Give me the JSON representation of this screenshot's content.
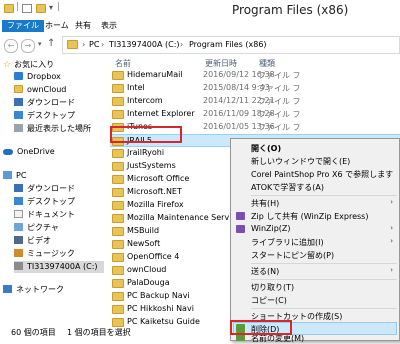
{
  "window": {
    "title": "Program Files (x86)"
  },
  "ribbon": {
    "tabs": [
      "ファイル",
      "ホーム",
      "共有",
      "表示"
    ]
  },
  "address": {
    "crumbs": [
      "PC",
      "TI31397400A (C:)",
      "Program Files (x86)"
    ]
  },
  "navpane": {
    "favorites_label": "お気に入り",
    "favorites": [
      "Dropbox",
      "ownCloud",
      "ダウンロード",
      "デスクトップ",
      "最近表示した場所"
    ],
    "onedrive": "OneDrive",
    "pc": "PC",
    "pc_items": [
      "ダウンロード",
      "デスクトップ",
      "ドキュメント",
      "ピクチャ",
      "ビデオ",
      "ミュージック",
      "TI31397400A (C:)"
    ],
    "network": "ネットワーク"
  },
  "columns": {
    "name": "名前",
    "date": "更新日時",
    "type": "種類"
  },
  "files": [
    {
      "name": "HidemaruMail",
      "date": "2016/09/12 16:38",
      "type": "ファイル フ"
    },
    {
      "name": "Intel",
      "date": "2015/08/14 9:43",
      "type": "ファイル フ"
    },
    {
      "name": "Intercom",
      "date": "2014/12/11 22:21",
      "type": "ファイル フ"
    },
    {
      "name": "Internet Explorer",
      "date": "2016/11/09 18:28",
      "type": "ファイル フ"
    },
    {
      "name": "iTunes",
      "date": "2016/01/05 13:36",
      "type": "ファイル フ"
    },
    {
      "name": "JRAIL5",
      "date": "",
      "type": ""
    },
    {
      "name": "JrailRyohi",
      "date": "",
      "type": ""
    },
    {
      "name": "JustSystems",
      "date": "",
      "type": ""
    },
    {
      "name": "Microsoft Office",
      "date": "",
      "type": ""
    },
    {
      "name": "Microsoft.NET",
      "date": "",
      "type": ""
    },
    {
      "name": "Mozilla Firefox",
      "date": "",
      "type": ""
    },
    {
      "name": "Mozilla Maintenance Service",
      "date": "",
      "type": ""
    },
    {
      "name": "MSBuild",
      "date": "",
      "type": ""
    },
    {
      "name": "NewSoft",
      "date": "",
      "type": ""
    },
    {
      "name": "OpenOffice 4",
      "date": "",
      "type": ""
    },
    {
      "name": "ownCloud",
      "date": "",
      "type": ""
    },
    {
      "name": "PalaDouga",
      "date": "",
      "type": ""
    },
    {
      "name": "PC Backup Navi",
      "date": "",
      "type": ""
    },
    {
      "name": "PC Hikkoshi Navi",
      "date": "",
      "type": ""
    },
    {
      "name": "PC Kaiketsu Guide",
      "date": "",
      "type": ""
    }
  ],
  "context_menu": {
    "open": "開く(O)",
    "open_new_window": "新しいウィンドウで開く(E)",
    "corel": "Corel PaintShop Pro X6 で参照します",
    "atok": "ATOKで学習する(A)",
    "share": "共有(H)",
    "zip_share": "Zip して共有 (WinZip Express)",
    "winzip": "WinZip(Z)",
    "library": "ライブラリに追加(I)",
    "pin_start": "スタートにピン留め(P)",
    "send_to": "送る(N)",
    "cut": "切り取り(T)",
    "copy": "コピー(C)",
    "create_shortcut": "ショートカットの作成(S)",
    "delete": "削除(D)",
    "rename": "名前の変更(M)"
  },
  "status": {
    "count": "60 個の項目",
    "selected": "1 個の項目を選択"
  },
  "colors": {
    "file_tab": "#1979ca",
    "highlight": "#d8272b",
    "folder": "#e8c357",
    "selection": "#cce8ff"
  }
}
